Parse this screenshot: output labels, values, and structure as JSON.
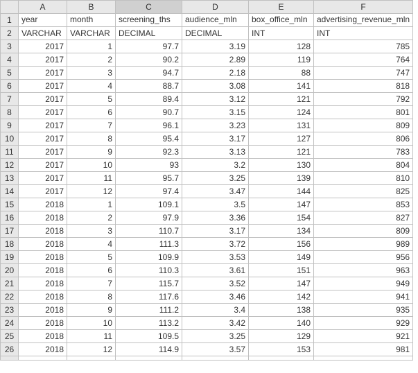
{
  "columns": [
    "A",
    "B",
    "C",
    "D",
    "E",
    "F"
  ],
  "selected_column": "C",
  "header_row": {
    "A": "year",
    "B": "month",
    "C": "screening_ths",
    "D": "audience_mln",
    "E": "box_office_mln",
    "F": "advertising_revenue_mln"
  },
  "type_row": {
    "A": "VARCHAR",
    "B": "VARCHAR",
    "C": "DECIMAL",
    "D": "DECIMAL",
    "E": "INT",
    "F": "INT"
  },
  "data_rows": [
    {
      "r": 3,
      "A": "2017",
      "B": "1",
      "C": "97.7",
      "D": "3.19",
      "E": "128",
      "F": "785"
    },
    {
      "r": 4,
      "A": "2017",
      "B": "2",
      "C": "90.2",
      "D": "2.89",
      "E": "119",
      "F": "764"
    },
    {
      "r": 5,
      "A": "2017",
      "B": "3",
      "C": "94.7",
      "D": "2.18",
      "E": "88",
      "F": "747"
    },
    {
      "r": 6,
      "A": "2017",
      "B": "4",
      "C": "88.7",
      "D": "3.08",
      "E": "141",
      "F": "818"
    },
    {
      "r": 7,
      "A": "2017",
      "B": "5",
      "C": "89.4",
      "D": "3.12",
      "E": "121",
      "F": "792"
    },
    {
      "r": 8,
      "A": "2017",
      "B": "6",
      "C": "90.7",
      "D": "3.15",
      "E": "124",
      "F": "801"
    },
    {
      "r": 9,
      "A": "2017",
      "B": "7",
      "C": "96.1",
      "D": "3.23",
      "E": "131",
      "F": "809"
    },
    {
      "r": 10,
      "A": "2017",
      "B": "8",
      "C": "95.4",
      "D": "3.17",
      "E": "127",
      "F": "806"
    },
    {
      "r": 11,
      "A": "2017",
      "B": "9",
      "C": "92.3",
      "D": "3.13",
      "E": "121",
      "F": "783"
    },
    {
      "r": 12,
      "A": "2017",
      "B": "10",
      "C": "93",
      "D": "3.2",
      "E": "130",
      "F": "804"
    },
    {
      "r": 13,
      "A": "2017",
      "B": "11",
      "C": "95.7",
      "D": "3.25",
      "E": "139",
      "F": "810"
    },
    {
      "r": 14,
      "A": "2017",
      "B": "12",
      "C": "97.4",
      "D": "3.47",
      "E": "144",
      "F": "825"
    },
    {
      "r": 15,
      "A": "2018",
      "B": "1",
      "C": "109.1",
      "D": "3.5",
      "E": "147",
      "F": "853"
    },
    {
      "r": 16,
      "A": "2018",
      "B": "2",
      "C": "97.9",
      "D": "3.36",
      "E": "154",
      "F": "827"
    },
    {
      "r": 17,
      "A": "2018",
      "B": "3",
      "C": "110.7",
      "D": "3.17",
      "E": "134",
      "F": "809"
    },
    {
      "r": 18,
      "A": "2018",
      "B": "4",
      "C": "111.3",
      "D": "3.72",
      "E": "156",
      "F": "989"
    },
    {
      "r": 19,
      "A": "2018",
      "B": "5",
      "C": "109.9",
      "D": "3.53",
      "E": "149",
      "F": "956"
    },
    {
      "r": 20,
      "A": "2018",
      "B": "6",
      "C": "110.3",
      "D": "3.61",
      "E": "151",
      "F": "963"
    },
    {
      "r": 21,
      "A": "2018",
      "B": "7",
      "C": "115.7",
      "D": "3.52",
      "E": "147",
      "F": "949"
    },
    {
      "r": 22,
      "A": "2018",
      "B": "8",
      "C": "117.6",
      "D": "3.46",
      "E": "142",
      "F": "941"
    },
    {
      "r": 23,
      "A": "2018",
      "B": "9",
      "C": "111.2",
      "D": "3.4",
      "E": "138",
      "F": "935"
    },
    {
      "r": 24,
      "A": "2018",
      "B": "10",
      "C": "113.2",
      "D": "3.42",
      "E": "140",
      "F": "929"
    },
    {
      "r": 25,
      "A": "2018",
      "B": "11",
      "C": "109.5",
      "D": "3.25",
      "E": "129",
      "F": "921"
    },
    {
      "r": 26,
      "A": "2018",
      "B": "12",
      "C": "114.9",
      "D": "3.57",
      "E": "153",
      "F": "981"
    }
  ],
  "chart_data": {
    "type": "table",
    "title": "",
    "columns": [
      "year",
      "month",
      "screening_ths",
      "audience_mln",
      "box_office_mln",
      "advertising_revenue_mln"
    ],
    "column_types": [
      "VARCHAR",
      "VARCHAR",
      "DECIMAL",
      "DECIMAL",
      "INT",
      "INT"
    ],
    "rows": [
      [
        "2017",
        1,
        97.7,
        3.19,
        128,
        785
      ],
      [
        "2017",
        2,
        90.2,
        2.89,
        119,
        764
      ],
      [
        "2017",
        3,
        94.7,
        2.18,
        88,
        747
      ],
      [
        "2017",
        4,
        88.7,
        3.08,
        141,
        818
      ],
      [
        "2017",
        5,
        89.4,
        3.12,
        121,
        792
      ],
      [
        "2017",
        6,
        90.7,
        3.15,
        124,
        801
      ],
      [
        "2017",
        7,
        96.1,
        3.23,
        131,
        809
      ],
      [
        "2017",
        8,
        95.4,
        3.17,
        127,
        806
      ],
      [
        "2017",
        9,
        92.3,
        3.13,
        121,
        783
      ],
      [
        "2017",
        10,
        93,
        3.2,
        130,
        804
      ],
      [
        "2017",
        11,
        95.7,
        3.25,
        139,
        810
      ],
      [
        "2017",
        12,
        97.4,
        3.47,
        144,
        825
      ],
      [
        "2018",
        1,
        109.1,
        3.5,
        147,
        853
      ],
      [
        "2018",
        2,
        97.9,
        3.36,
        154,
        827
      ],
      [
        "2018",
        3,
        110.7,
        3.17,
        134,
        809
      ],
      [
        "2018",
        4,
        111.3,
        3.72,
        156,
        989
      ],
      [
        "2018",
        5,
        109.9,
        3.53,
        149,
        956
      ],
      [
        "2018",
        6,
        110.3,
        3.61,
        151,
        963
      ],
      [
        "2018",
        7,
        115.7,
        3.52,
        147,
        949
      ],
      [
        "2018",
        8,
        117.6,
        3.46,
        142,
        941
      ],
      [
        "2018",
        9,
        111.2,
        3.4,
        138,
        935
      ],
      [
        "2018",
        10,
        113.2,
        3.42,
        140,
        929
      ],
      [
        "2018",
        11,
        109.5,
        3.25,
        129,
        921
      ],
      [
        "2018",
        12,
        114.9,
        3.57,
        153,
        981
      ]
    ]
  }
}
